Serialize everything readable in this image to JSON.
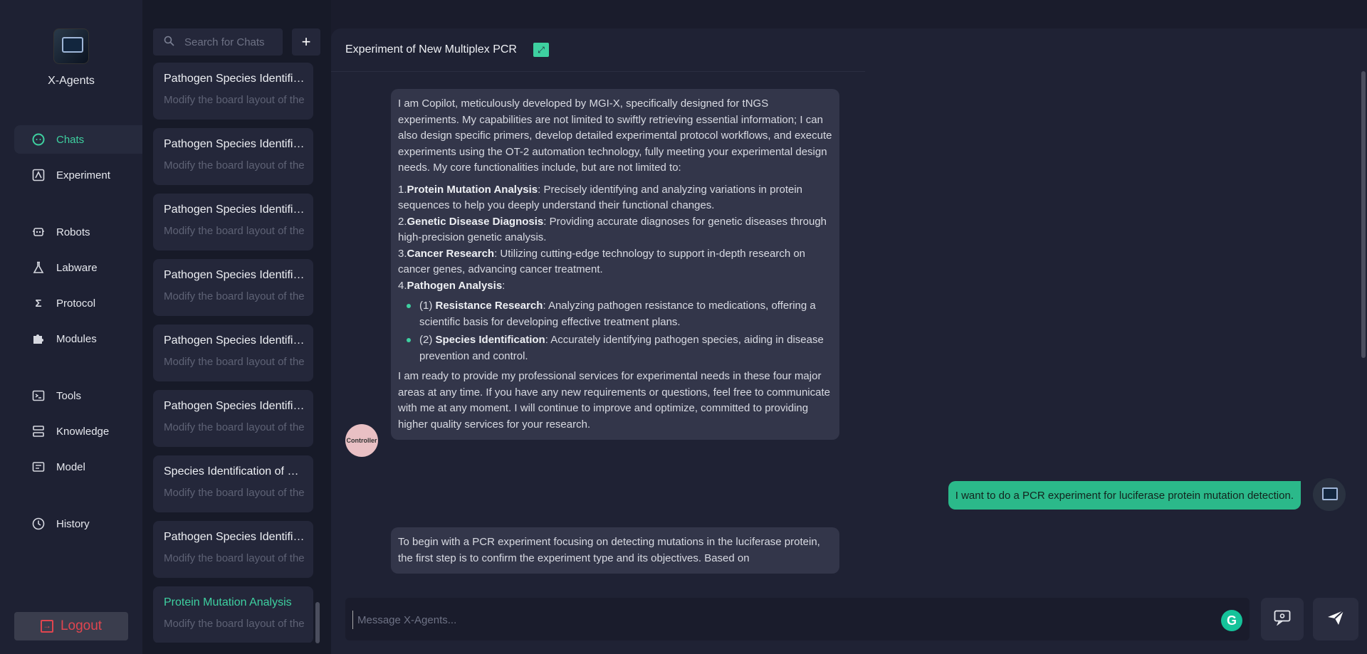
{
  "app": {
    "name": "X-Agents"
  },
  "nav": {
    "items": [
      {
        "label": "Chats",
        "icon": "chat-icon"
      },
      {
        "label": "Experiment",
        "icon": "experiment-icon"
      },
      {
        "label": "Robots",
        "icon": "robot-icon"
      },
      {
        "label": "Labware",
        "icon": "flask-icon"
      },
      {
        "label": "Protocol",
        "icon": "sigma-icon"
      },
      {
        "label": "Modules",
        "icon": "puzzle-icon"
      },
      {
        "label": "Tools",
        "icon": "terminal-icon"
      },
      {
        "label": "Knowledge",
        "icon": "stack-icon"
      },
      {
        "label": "Model",
        "icon": "model-icon"
      },
      {
        "label": "History",
        "icon": "clock-icon"
      }
    ],
    "logout": "Logout"
  },
  "search": {
    "placeholder": "Search for Chats"
  },
  "chats": [
    {
      "title": "Pathogen Species Identification",
      "subtitle": "Modify the board layout of the"
    },
    {
      "title": "Pathogen Species Identification",
      "subtitle": "Modify the board layout of the"
    },
    {
      "title": "Pathogen Species Identification",
      "subtitle": "Modify the board layout of the"
    },
    {
      "title": "Pathogen Species Identification",
      "subtitle": "Modify the board layout of the"
    },
    {
      "title": "Pathogen Species Identification",
      "subtitle": "Modify the board layout of the"
    },
    {
      "title": "Pathogen Species Identification",
      "subtitle": "Modify the board layout of the"
    },
    {
      "title": "Species Identification of Pathogens",
      "subtitle": "Modify the board layout of the"
    },
    {
      "title": "Pathogen Species Identification",
      "subtitle": "Modify the board layout of the"
    },
    {
      "title": "Protein Mutation Analysis",
      "subtitle": "Modify the board layout of the"
    }
  ],
  "conversation": {
    "title": "Experiment of New Multiplex PCR",
    "bot_avatar_label": "Controller",
    "intro": "I am Copilot, meticulously developed by MGI-X, specifically designed for tNGS experiments. My capabilities are not limited to swiftly retrieving essential information; I can also design specific primers, develop detailed experimental protocol workflows, and execute experiments using the OT-2 automation technology, fully meeting your experimental design needs. My core functionalities include, but are not limited to:",
    "f1_num": "1.",
    "f1_title": "Protein Mutation Analysis",
    "f1_text": ": Precisely identifying and analyzing variations in protein sequences to help you deeply understand their functional changes.",
    "f2_num": "2.",
    "f2_title": "Genetic Disease Diagnosis",
    "f2_text": ": Providing accurate diagnoses for genetic diseases through high-precision genetic analysis.",
    "f3_num": "3.",
    "f3_title": "Cancer Research",
    "f3_text": ": Utilizing cutting-edge technology to support in-depth research on cancer genes, advancing cancer treatment.",
    "f4_num": "4.",
    "f4_title": "Pathogen Analysis",
    "f4_text": ":",
    "s1_num": "(1) ",
    "s1_title": "Resistance Research",
    "s1_text": ": Analyzing pathogen resistance to medications, offering a scientific basis for developing effective treatment plans.",
    "s2_num": "(2) ",
    "s2_title": "Species Identification",
    "s2_text": ": Accurately identifying pathogen species, aiding in disease prevention and control.",
    "closing": "I am ready to provide my professional services for experimental needs in these four major areas at any time. If you have any new requirements or questions, feel free to communicate with me at any moment. I will continue to improve and optimize, committed to providing higher quality services for your research.",
    "user_message": "I want to do a PCR experiment for luciferase protein mutation detection.",
    "bot_reply": "To begin with a PCR experiment focusing on detecting mutations in the luciferase protein, the first step is to confirm the experiment type and its objectives. Based on"
  },
  "composer": {
    "placeholder": "Message X-Agents...",
    "grammarly_label": "G"
  },
  "colors": {
    "accent": "#3ed0a0",
    "logout": "#e0454f",
    "user_bubble": "#2bb98a"
  }
}
